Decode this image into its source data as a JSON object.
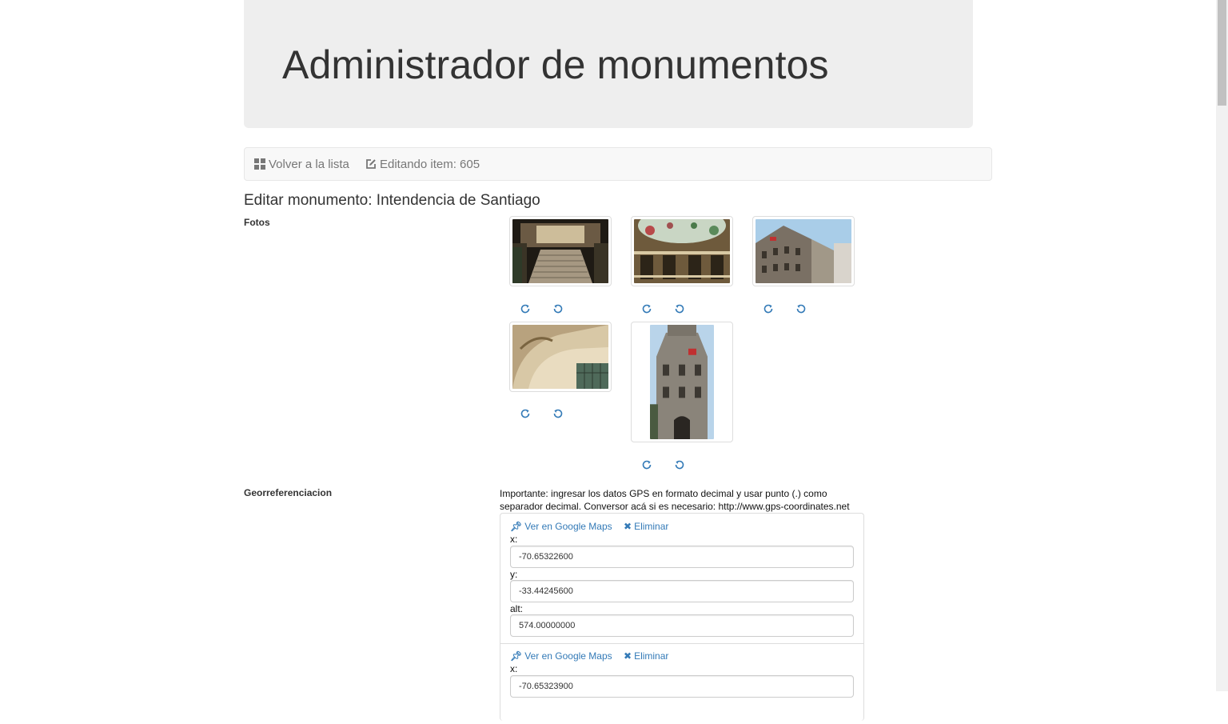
{
  "header": {
    "title": "Administrador de monumentos"
  },
  "nav": {
    "back_label": "Volver a la lista",
    "editing_label": "Editando item: 605"
  },
  "page": {
    "title": "Editar monumento: Intendencia de Santiago"
  },
  "sections": {
    "photos_label": "Fotos",
    "geo_label": "Georreferenciacion"
  },
  "photos": [
    {
      "name": "staircase-interior",
      "orientation": "landscape"
    },
    {
      "name": "dome-stained-glass",
      "orientation": "landscape"
    },
    {
      "name": "building-corner-facade",
      "orientation": "landscape"
    },
    {
      "name": "ceiling-arch-detail",
      "orientation": "landscape"
    },
    {
      "name": "tower-facade",
      "orientation": "portrait"
    }
  ],
  "icons": {
    "rotate_right": "rotate-clockwise-icon",
    "rotate_left": "rotate-counterclockwise-icon",
    "pin": "pushpin-icon",
    "remove": "remove-x-icon",
    "grid": "th-large-icon",
    "edit": "edit-icon"
  },
  "geo": {
    "help": "Importante: ingresar los datos GPS en formato decimal y usar punto (.) como separador decimal. Conversor acá si es necesario: http://www.gps-coordinates.net",
    "map_link": "Ver en Google Maps",
    "delete_link": "Eliminar",
    "points": [
      {
        "x_label": "x:",
        "x": "-70.65322600",
        "y_label": "y:",
        "y": "-33.44245600",
        "alt_label": "alt:",
        "alt": "574.00000000"
      },
      {
        "x_label": "x:",
        "x": "-70.65323900"
      }
    ]
  },
  "colors": {
    "link": "#337ab7",
    "jumbotron_bg": "#eeeeee",
    "navbar_bg": "#f8f8f8"
  }
}
